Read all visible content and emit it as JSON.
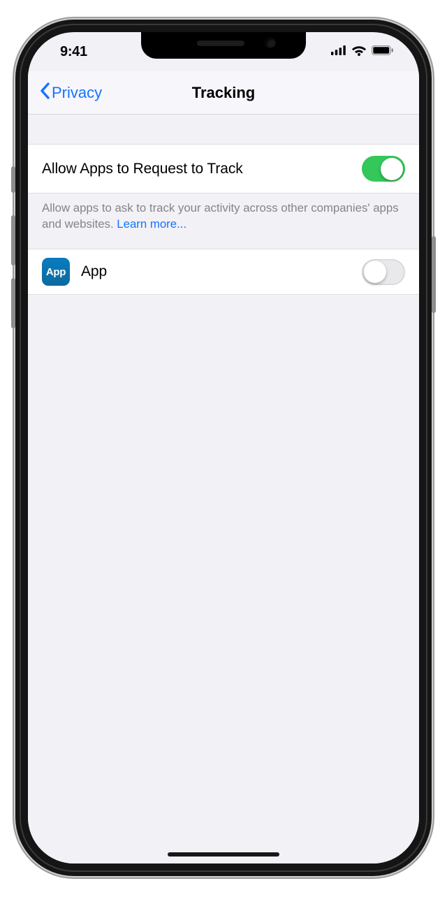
{
  "status": {
    "time": "9:41"
  },
  "nav": {
    "back_label": "Privacy",
    "title": "Tracking"
  },
  "master": {
    "label": "Allow Apps to Request to Track",
    "footer_text": "Allow apps to ask to track your activity across other companies' apps and websites. ",
    "learn_more": "Learn more...",
    "on": true
  },
  "apps": [
    {
      "icon_text": "App",
      "name": "App",
      "on": false
    }
  ]
}
